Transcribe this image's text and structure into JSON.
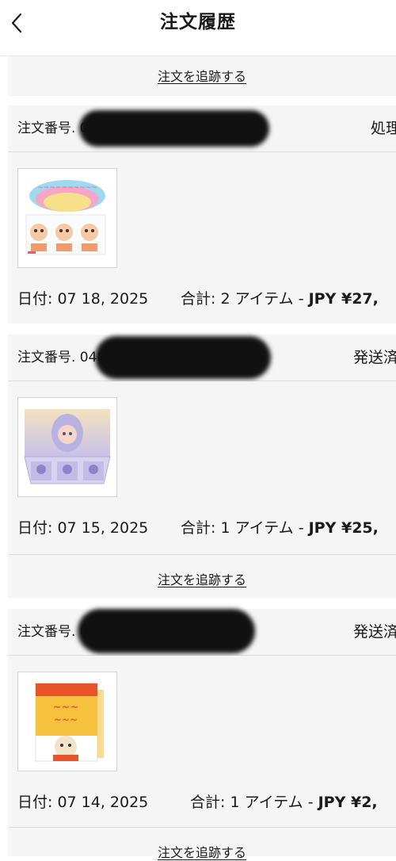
{
  "header": {
    "title": "注文履歴",
    "back_icon": "chevron-left-icon"
  },
  "track_label": "注文を追跡する",
  "orders": [
    {
      "order_label": "注文番号. 04",
      "status": "処理",
      "date": "日付: 07 18, 2025",
      "total_prefix": "合計: 2 アイテム  -  ",
      "total_price": "JPY ¥27,",
      "product_colors": [
        "#f6c9a4",
        "#f29c6b",
        "#e85d75"
      ]
    },
    {
      "order_label": "注文番号. 048",
      "status": "発送済",
      "date": "日付: 07 15, 2025",
      "total_prefix": "合計: 1 アイテム  -  ",
      "total_price": "JPY ¥25,",
      "product_colors": [
        "#b9b2e0",
        "#8d84c8",
        "#f0d7b0"
      ]
    },
    {
      "order_label": "注文番号. 07",
      "status": "発送済",
      "date": "日付: 07 14, 2025",
      "total_prefix": "合計: 1 アイテム  -  ",
      "total_price": "JPY ¥2,",
      "product_colors": [
        "#e8542a",
        "#f6c23e",
        "#ffffff"
      ]
    }
  ]
}
